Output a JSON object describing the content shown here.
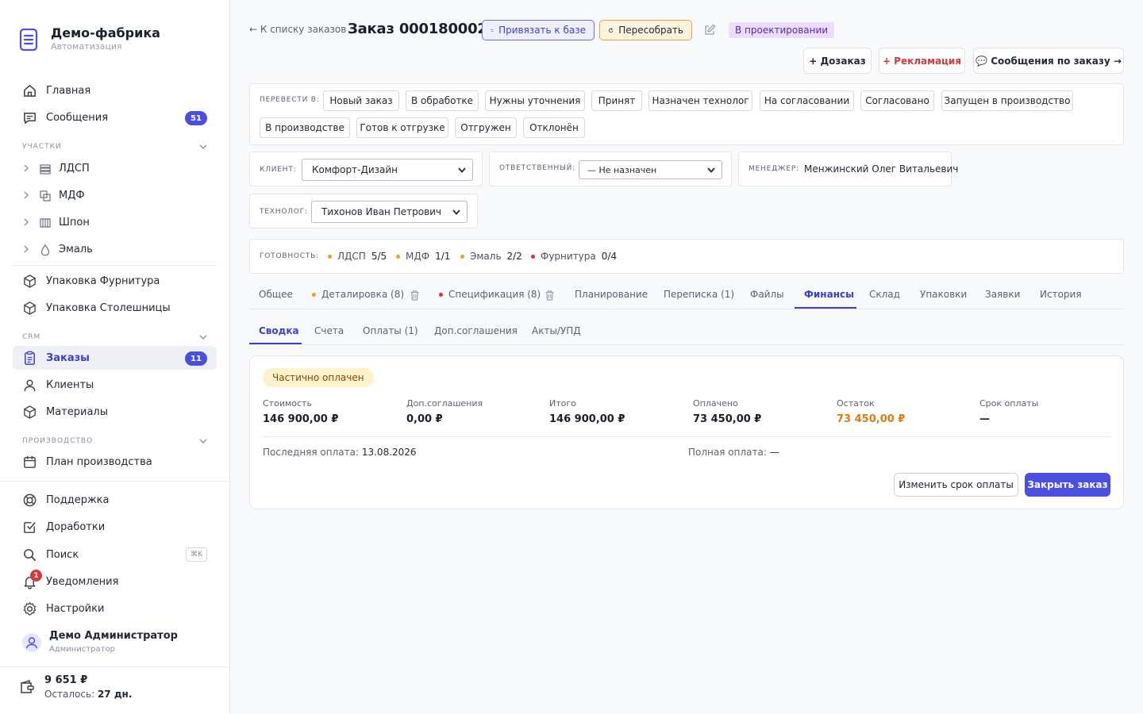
{
  "app": {
    "title": "Демо-фабрика",
    "subtitle": "Автоматизация"
  },
  "sidebar": {
    "home": "Главная",
    "messages": {
      "label": "Сообщения",
      "badge": "51"
    },
    "sections": {
      "areas": "УЧАСТКИ",
      "crm": "CRM",
      "production": "ПРОИЗВОДСТВО"
    },
    "areas": [
      {
        "label": "ЛДСП",
        "icon": "layers-icon"
      },
      {
        "label": "МДФ",
        "icon": "stack-icon"
      },
      {
        "label": "Шпон",
        "icon": "veneer-icon"
      },
      {
        "label": "Эмаль",
        "icon": "drop-icon"
      }
    ],
    "packaging": [
      "Упаковка Фурнитура",
      "Упаковка Столешницы"
    ],
    "crm": {
      "orders": {
        "label": "Заказы",
        "badge": "11"
      },
      "clients": "Клиенты",
      "materials": "Материалы"
    },
    "plan": "План производства",
    "support": "Поддержка",
    "improvements": "Доработки",
    "search": {
      "label": "Поиск",
      "shortcut": "⌘K"
    },
    "notifications": {
      "label": "Уведомления",
      "badge": "1"
    },
    "settings": "Настройки",
    "user": {
      "name": "Демо Администратор",
      "role": "Администратор"
    },
    "wallet": {
      "amount": "9 651 ₽",
      "left_label": "Осталось:",
      "left_value": "27 дн."
    }
  },
  "header": {
    "back": "← К списку заказов",
    "title": "Заказ 0001800026",
    "bind_button": "Привязать к базе",
    "rebuild_button": "Пересобрать",
    "status": "В проектировании",
    "extra_order": "+ Дозаказ",
    "claim": "+ Рекламация",
    "messages": "💬 Сообщения по заказу →"
  },
  "transfer": {
    "label": "ПЕРЕВЕСТИ В:",
    "statuses": [
      "Новый заказ",
      "В обработке",
      "Нужны уточнения",
      "Принят",
      "Назначен технолог",
      "На согласовании",
      "Согласовано",
      "Запущен в производство",
      "В производстве",
      "Готов к отгрузке",
      "Отгружен",
      "Отклонён"
    ]
  },
  "fields": {
    "client": {
      "label": "КЛИЕНТ:",
      "value": "Комфорт-Дизайн"
    },
    "responsible": {
      "label": "ОТВЕТСТВЕННЫЙ:",
      "value": "— Не назначен"
    },
    "manager": {
      "label": "МЕНЕДЖЕР:",
      "value": "Менжинский Олег Витальевич"
    },
    "technologist": {
      "label": "ТЕХНОЛОГ:",
      "value": "Тихонов Иван Петрович"
    }
  },
  "readiness": {
    "label": "ГОТОВНОСТЬ:",
    "items": [
      {
        "name": "ЛДСП",
        "value": "5/5",
        "color": "#f0a020"
      },
      {
        "name": "МДФ",
        "value": "1/1",
        "color": "#f0a020"
      },
      {
        "name": "Эмаль",
        "value": "2/2",
        "color": "#f0a020"
      },
      {
        "name": "Фурнитура",
        "value": "0/4",
        "color": "#e03030"
      }
    ]
  },
  "tabs": [
    "Общее",
    "Деталировка (8)",
    "Спецификация (8)",
    "Планирование",
    "Переписка (1)",
    "Файлы",
    "Финансы",
    "Склад",
    "Упаковки",
    "Заявки",
    "История"
  ],
  "tab_dots": {
    "detail": "#f0a020",
    "spec": "#e03030"
  },
  "subtabs": [
    "Сводка",
    "Счета",
    "Оплаты (1)",
    "Доп.соглашения",
    "Акты/УПД"
  ],
  "finance": {
    "status": "Частично оплачен",
    "columns": [
      {
        "label": "Стоимость",
        "value": "146 900,00 ₽"
      },
      {
        "label": "Доп.соглашения",
        "value": "0,00 ₽"
      },
      {
        "label": "Итого",
        "value": "146 900,00 ₽"
      },
      {
        "label": "Оплачено",
        "value": "73 450,00 ₽"
      },
      {
        "label": "Остаток",
        "value": "73 450,00 ₽"
      },
      {
        "label": "Срок оплаты",
        "value": "—"
      }
    ],
    "last_payment": {
      "label": "Последняя оплата:",
      "value": "13.08.2026"
    },
    "full_payment": {
      "label": "Полная оплата:",
      "value": "—"
    },
    "change_term": "Изменить срок оплаты",
    "close_order": "Закрыть заказ"
  },
  "colors": {
    "accent": "#4a4fe0",
    "warning": "#e47a12",
    "danger": "#d33a3a",
    "status_bg": "#ecdcff"
  }
}
